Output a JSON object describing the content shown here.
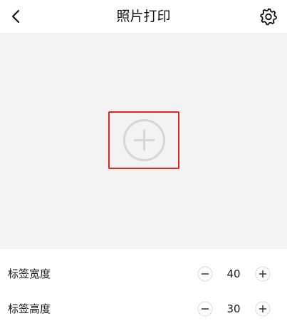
{
  "header": {
    "title": "照片打印",
    "back_icon": "chevron-left-icon",
    "settings_icon": "gear-icon"
  },
  "canvas": {
    "add_icon": "plus-circle-icon",
    "highlight_color": "#e0261d",
    "background_color": "#f3f3f4"
  },
  "settings": {
    "label_width": {
      "label": "标签宽度",
      "value": "40"
    },
    "label_height": {
      "label": "标签高度",
      "value": "30"
    }
  }
}
